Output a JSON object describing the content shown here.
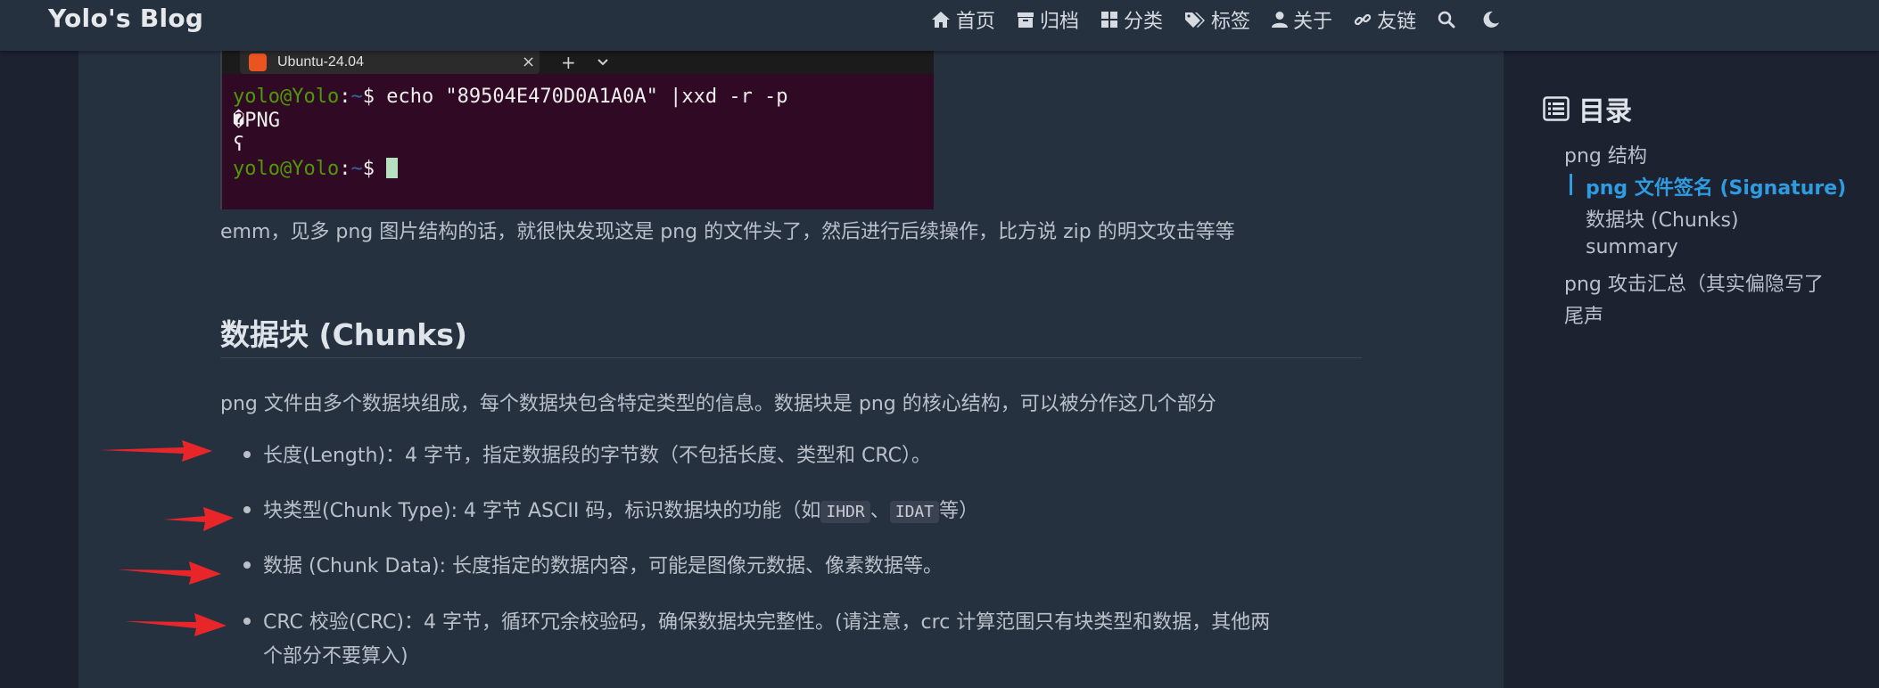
{
  "nav": {
    "brand": "Yolo's Blog",
    "items": [
      {
        "icon": "home-icon",
        "label": "首页"
      },
      {
        "icon": "archive-icon",
        "label": "归档"
      },
      {
        "icon": "categories-icon",
        "label": "分类"
      },
      {
        "icon": "tags-icon",
        "label": "标签"
      },
      {
        "icon": "user-icon",
        "label": "关于"
      },
      {
        "icon": "link-icon",
        "label": "友链"
      }
    ]
  },
  "terminal": {
    "tab_title": "Ubuntu-24.04",
    "close": "×",
    "plus": "+",
    "chevron": "⌄",
    "line1_user": "yolo@Yolo",
    "line1_sep": ":",
    "line1_path": "~",
    "line1_cmd": "$ echo \"89504E470D0A1A0A\" |xxd -r -p",
    "line2": "�PNG",
    "line3": "ʕ",
    "line4_user": "yolo@Yolo",
    "line4_sep": ":",
    "line4_path": "~",
    "line4_cmd": "$ "
  },
  "article": {
    "para1": "emm，见多 png 图片结构的话，就很快发现这是 png 的文件头了，然后进行后续操作，比方说 zip 的明文攻击等等",
    "heading": "数据块 (Chunks)",
    "para2": "png 文件由多个数据块组成，每个数据块包含特定类型的信息。数据块是 png 的核心结构，可以被分作这几个部分",
    "bullets": {
      "b1": "长度(Length)：4 字节，指定数据段的字节数（不包括长度、类型和 CRC）。",
      "b2_pre": "块类型(Chunk Type): 4 字节 ASCII 码，标识数据块的功能（如",
      "b2_code1": "IHDR",
      "b2_mid": "、",
      "b2_code2": "IDAT",
      "b2_post": "等）",
      "b3": "数据 (Chunk Data): 长度指定的数据内容，可能是图像元数据、像素数据等。",
      "b4_line1": "CRC 校验(CRC)：4 字节，循环冗余校验码，确保数据块完整性。(请注意，crc 计算范围只有块类型和数据，其他两",
      "b4_line2": "个部分不要算入)"
    }
  },
  "toc": {
    "title": "目录",
    "items": {
      "i1": "png 结构",
      "i2": "png 文件签名 (Signature)",
      "i3": "数据块 (Chunks)",
      "i4": "summary",
      "i5": "png 攻击汇总（其实偏隐写了",
      "i6": "尾声"
    }
  },
  "colors": {
    "nav_bg": "#263140",
    "page_bg": "#1c2230",
    "accent": "#2f9be0",
    "arrow": "#e8262a",
    "terminal_bg": "#300a24"
  }
}
